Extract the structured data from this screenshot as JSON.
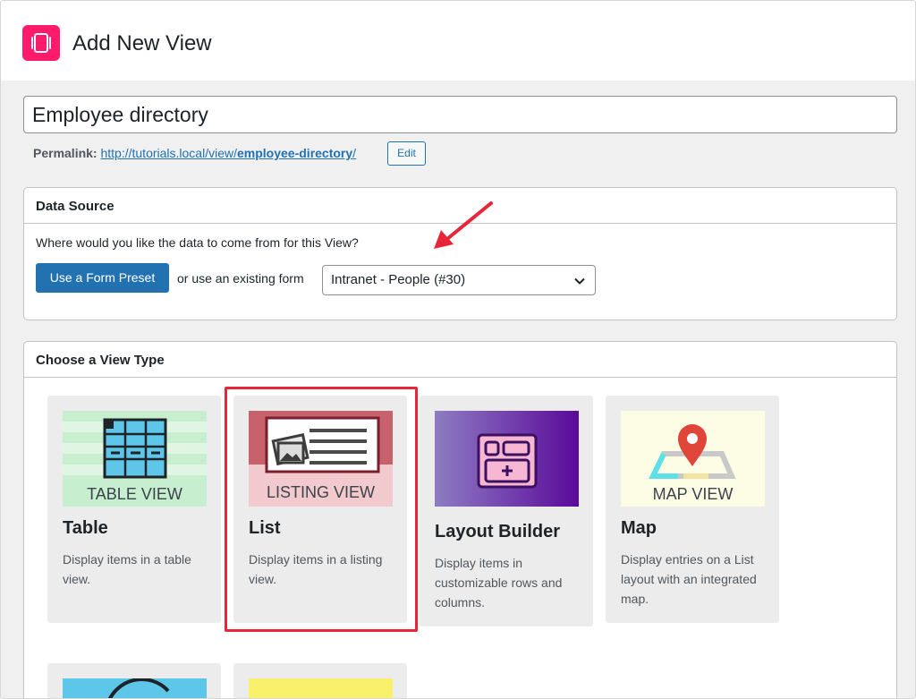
{
  "header": {
    "title": "Add New View",
    "logo_icon": "gravityview-logo-icon",
    "logo_color": "#ff1b6b"
  },
  "view_title": {
    "value": "Employee directory"
  },
  "permalink": {
    "label": "Permalink:",
    "url_base": "http://tutorials.local/view/",
    "slug": "employee-directory",
    "url_trail": "/",
    "edit_label": "Edit"
  },
  "data_source": {
    "heading": "Data Source",
    "question": "Where would you like the data to come from for this View?",
    "preset_button": "Use a Form Preset",
    "or_text": "or use an existing form",
    "selected_form": "Intranet - People (#30)"
  },
  "view_type": {
    "heading": "Choose a View Type",
    "cards": [
      {
        "name": "Table",
        "thumb_text": "TABLE VIEW",
        "description": "Display items in a table view."
      },
      {
        "name": "List",
        "thumb_text": "LISTING VIEW",
        "description": "Display items in a listing view.",
        "selected": true
      },
      {
        "name": "Layout Builder",
        "thumb_text": "",
        "description": "Display items in customizable rows and columns."
      },
      {
        "name": "Map",
        "thumb_text": "MAP VIEW",
        "description": "Display entries on a List layout with an integrated map."
      }
    ]
  },
  "colors": {
    "accent": "#2271b1",
    "highlight": "#e7263c",
    "arrow": "#e7263c"
  }
}
